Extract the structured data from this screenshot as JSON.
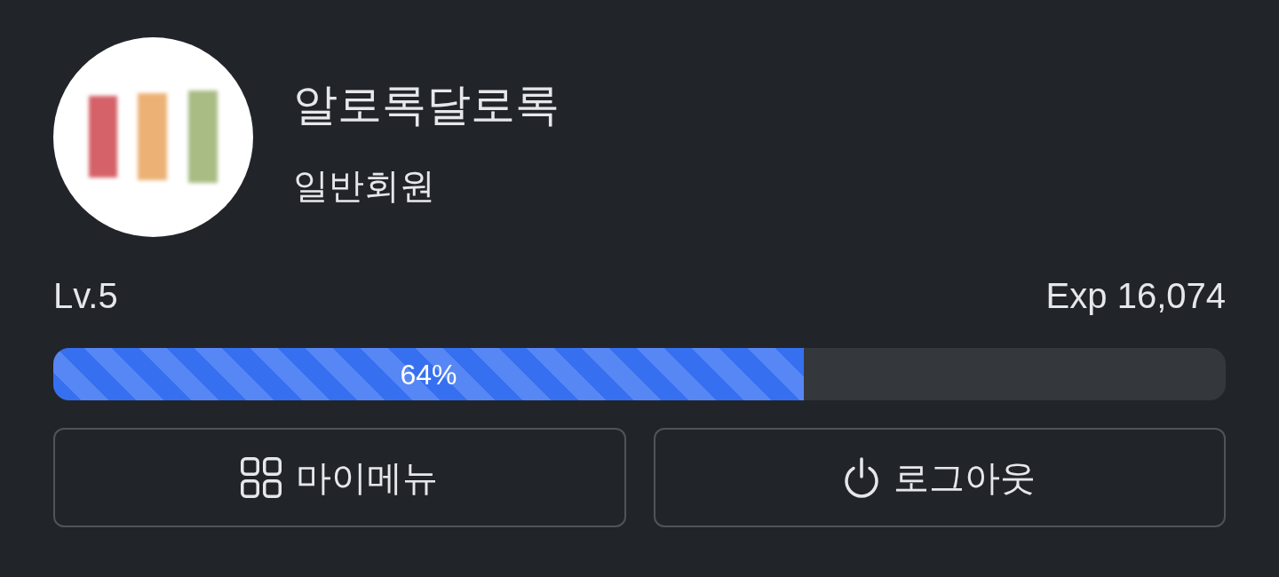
{
  "profile": {
    "name": "알로록달로록",
    "grade": "일반회원"
  },
  "progress": {
    "level_label": "Lv.5",
    "exp_label": "Exp 16,074",
    "level": 0.64,
    "reading": "64%"
  },
  "buttons": [
    {
      "label": "마이메뉴",
      "kind": "grid"
    },
    {
      "label": "로그아웃",
      "kind": "power"
    }
  ]
}
